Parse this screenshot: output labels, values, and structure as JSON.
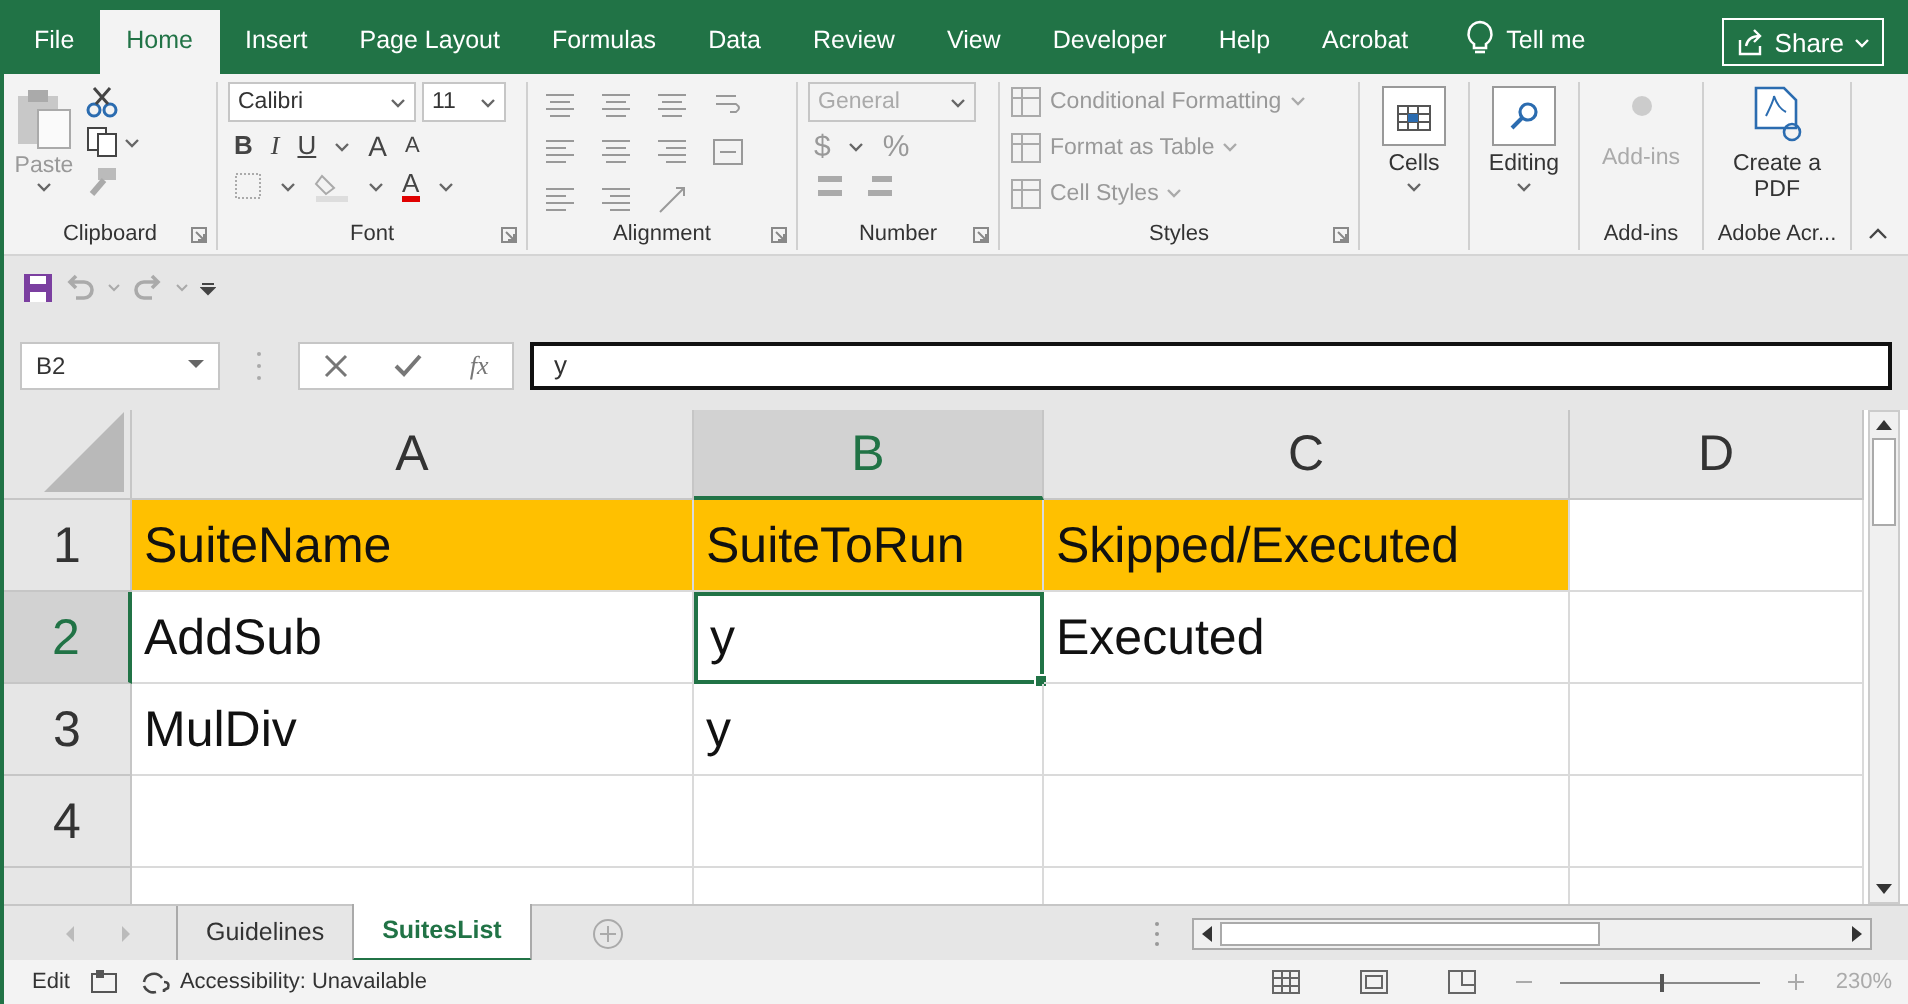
{
  "tabs": [
    {
      "label": "File",
      "selected": false
    },
    {
      "label": "Home",
      "selected": true
    },
    {
      "label": "Insert",
      "selected": false
    },
    {
      "label": "Page Layout",
      "selected": false
    },
    {
      "label": "Formulas",
      "selected": false
    },
    {
      "label": "Data",
      "selected": false
    },
    {
      "label": "Review",
      "selected": false
    },
    {
      "label": "View",
      "selected": false
    },
    {
      "label": "Developer",
      "selected": false
    },
    {
      "label": "Help",
      "selected": false
    },
    {
      "label": "Acrobat",
      "selected": false
    }
  ],
  "tell_me": "Tell me",
  "share": "Share",
  "ribbon": {
    "clipboard": {
      "paste": "Paste",
      "label": "Clipboard"
    },
    "font": {
      "name": "Calibri",
      "size": "11",
      "bold": "B",
      "italic": "I",
      "underline": "U",
      "grow": "A",
      "shrink": "A",
      "color_letter": "A",
      "label": "Font"
    },
    "alignment": {
      "label": "Alignment"
    },
    "number": {
      "format": "General",
      "currency": "$",
      "percent": "%",
      "label": "Number"
    },
    "styles": {
      "items": [
        "Conditional Formatting",
        "Format as Table",
        "Cell Styles"
      ],
      "label": "Styles"
    },
    "cells": {
      "button": "Cells"
    },
    "editing": {
      "button": "Editing"
    },
    "addins": {
      "button": "Add-ins",
      "label": "Add-ins"
    },
    "adobe": {
      "button": "Create a PDF",
      "label": "Adobe Acr..."
    }
  },
  "formula_bar": {
    "name_box": "B2",
    "fx": "fx",
    "value": "y"
  },
  "columns": [
    {
      "label": "A",
      "selected": false
    },
    {
      "label": "B",
      "selected": true
    },
    {
      "label": "C",
      "selected": false
    },
    {
      "label": "D",
      "selected": false
    }
  ],
  "rows": [
    {
      "number": "1",
      "selected": false,
      "cells": [
        {
          "text": "SuiteName",
          "highlighted": true,
          "selected": false
        },
        {
          "text": "SuiteToRun",
          "highlighted": true,
          "selected": false
        },
        {
          "text": "Skipped/Executed",
          "highlighted": true,
          "selected": false
        },
        {
          "highlighted": false,
          "selected": false
        }
      ]
    },
    {
      "number": "2",
      "selected": true,
      "cells": [
        {
          "text": "AddSub",
          "highlighted": false,
          "selected": false
        },
        {
          "text": "y",
          "highlighted": false,
          "selected": true
        },
        {
          "text": "Executed",
          "highlighted": false,
          "selected": false
        },
        {
          "highlighted": false,
          "selected": false
        }
      ]
    },
    {
      "number": "3",
      "selected": false,
      "cells": [
        {
          "text": "MulDiv",
          "highlighted": false,
          "selected": false
        },
        {
          "text": "y",
          "highlighted": false,
          "selected": false
        },
        {
          "highlighted": false,
          "selected": false
        },
        {
          "highlighted": false,
          "selected": false
        }
      ]
    },
    {
      "number": "4",
      "selected": false,
      "cells": [
        {
          "highlighted": false,
          "selected": false
        },
        {
          "highlighted": false,
          "selected": false
        },
        {
          "highlighted": false,
          "selected": false
        },
        {
          "highlighted": false,
          "selected": false
        }
      ]
    },
    {
      "selected": false,
      "cells": [
        {
          "highlighted": false,
          "selected": false
        },
        {
          "highlighted": false,
          "selected": false
        },
        {
          "highlighted": false,
          "selected": false
        },
        {
          "highlighted": false,
          "selected": false
        }
      ]
    }
  ],
  "sheets": [
    {
      "label": "Guidelines",
      "selected": false
    },
    {
      "label": "SuitesList",
      "selected": true
    }
  ],
  "status_bar": {
    "mode": "Edit",
    "accessibility": "Accessibility: Unavailable",
    "zoom": "230%",
    "zoom_level": {
      "level": 0.5
    }
  }
}
